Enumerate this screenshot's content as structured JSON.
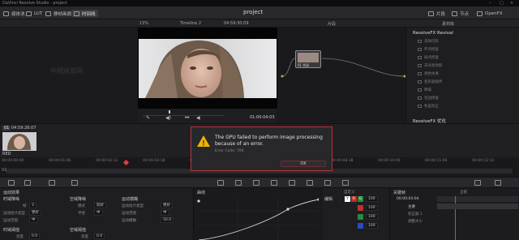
{
  "titlebar": {
    "app_title": "DaVinci Resolve Studio - project",
    "menus": [
      "DaVinci Resolve",
      "文件",
      "编辑",
      "修剪",
      "时间线",
      "片段",
      "标记",
      "显示",
      "播放",
      "Fusion",
      "调色",
      "Fairlight",
      "工作区",
      "帮助"
    ],
    "minimize": "–",
    "maximize": "□",
    "close": "×"
  },
  "toolbar": {
    "media_pool": "媒体池",
    "lut": "LUT",
    "media": "静帧画廊",
    "timeline": "时间线",
    "project_name": "project",
    "clips": "片段",
    "node": "节点",
    "openfx": "OpenFX",
    "lightbox": "光箱"
  },
  "viewerbar": {
    "zoom": "13%",
    "timeline_name": "Timeline 2",
    "timecode": "04:59:30:09",
    "clip_label": "片段",
    "tracker_label": "关键帧",
    "right_tab": "素材库"
  },
  "viewer": {
    "watermark": "中相迷部网",
    "timecode": "01:00:04:03"
  },
  "nodes": {
    "node_label": "01 色彩"
  },
  "openfx": {
    "header": "ResolveFX Revival",
    "items": [
      "去除闪烁",
      "坏点修复",
      "斑点修复",
      "去块状伪影",
      "调色失真",
      "变形器插件",
      "降噪",
      "毛边修复",
      "色差校正",
      "修补"
    ],
    "header2": "ResolveFX 优化"
  },
  "clip": {
    "number": "01",
    "timecode": "04:59:26:07",
    "track": "V1",
    "label": "RED"
  },
  "timeline_ruler": [
    "00:00:00:00",
    "00:00:01:06",
    "00:00:02:12",
    "00:00:03:18",
    "00:00:05:00",
    "00:00:06:06",
    "00:00:07:12",
    "00:00:08:18",
    "00:00:10:00",
    "00:00:11:06",
    "00:00:12:12"
  ],
  "dialog": {
    "message_line1": "The GPU failed to perform image processing",
    "message_line2": "because of an error.",
    "error_code": "Error Code: 700.",
    "ok": "OK",
    "warning_glyph": "!"
  },
  "motion_panel": {
    "title": "运动效果",
    "temporal_title": "时域降噪",
    "frames_label": "帧",
    "frames_value": "3",
    "motion_estimation_label": "运动估计类型",
    "motion_estimation_value": "更好",
    "motion_range_label": "运动范围",
    "motion_range_value": "中",
    "spatial_title": "空域降噪",
    "mode_label": "模式",
    "mode_value": "较好",
    "radius_label": "半径",
    "radius_value": "中",
    "blur_title": "运动模糊",
    "blur_estimation_label": "运动估计类型",
    "blur_estimation_value": "更好",
    "blur_range_label": "运动范围",
    "blur_range_value": "中",
    "blur_amount_label": "运动模糊",
    "blur_amount_value": "50.0",
    "threshold_title": "时域阈值",
    "luma_label": "亮度",
    "luma_value": "0.0",
    "spatial_threshold_title": "空域阈值",
    "spatial_luma_label": "亮度",
    "spatial_luma_value": "0.0",
    "chroma_value": "0.0"
  },
  "curves_panel": {
    "title": "曲线",
    "custom_label": "自定义"
  },
  "edit_panel": {
    "title": "编辑",
    "values": [
      "100",
      "100",
      "100",
      "100"
    ]
  },
  "keyframes_panel": {
    "title": "关键帧",
    "all_label": "全部",
    "timecode": "00:00:04:04",
    "tracks": [
      "主要",
      "校正器 1",
      "调整大小"
    ]
  },
  "colors": {
    "accent_red": "#b3343c",
    "warning_yellow": "#f0b400",
    "playhead": "#e04040"
  }
}
